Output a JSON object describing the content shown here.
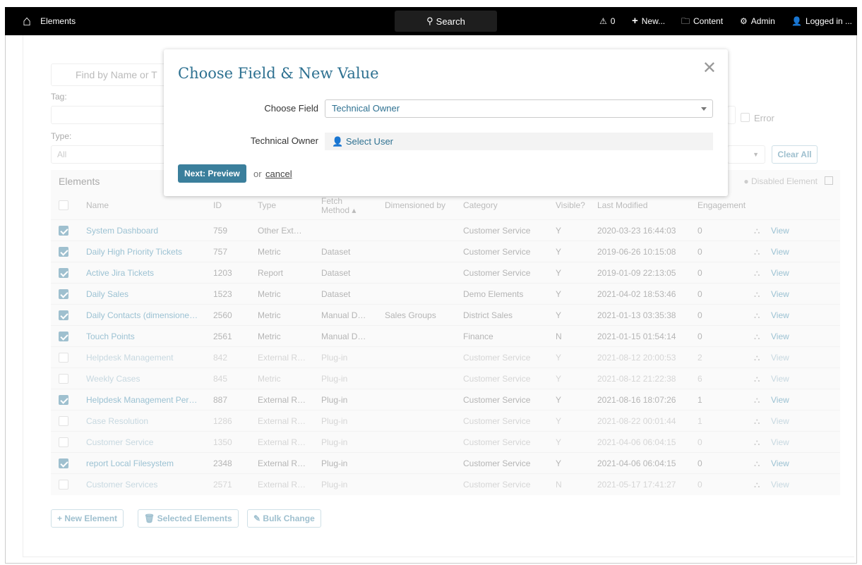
{
  "topbar": {
    "title": "Elements",
    "search": "Search",
    "alerts": "0",
    "new": "New...",
    "content": "Content",
    "admin": "Admin",
    "user": "Logged in ..."
  },
  "filters": {
    "search_placeholder": "Find by Name or T",
    "tag_label": "Tag:",
    "type_label": "Type:",
    "type_value": "All",
    "error_label": "Error",
    "clear_all": "Clear All"
  },
  "table": {
    "title": "Elements",
    "legend": "Disabled Element",
    "columns": [
      "Name",
      "ID",
      "Type",
      "Fetch Method",
      "Dimensioned by",
      "Category",
      "Visible?",
      "Last Modified",
      "Engagement"
    ],
    "view_label": "View",
    "rows": [
      {
        "checked": true,
        "disabled": false,
        "name": "System Dashboard",
        "id": "759",
        "type": "Other Ext…",
        "fetch": "",
        "dim": "",
        "category": "Customer Service",
        "visible": "Y",
        "modified": "2020-03-23 16:44:03",
        "engagement": "0"
      },
      {
        "checked": true,
        "disabled": false,
        "name": "Daily High Priority Tickets",
        "id": "757",
        "type": "Metric",
        "fetch": "Dataset",
        "dim": "",
        "category": "Customer Service",
        "visible": "Y",
        "modified": "2019-06-26 10:15:08",
        "engagement": "0"
      },
      {
        "checked": true,
        "disabled": false,
        "name": "Active Jira Tickets",
        "id": "1203",
        "type": "Report",
        "fetch": "Dataset",
        "dim": "",
        "category": "Customer Service",
        "visible": "Y",
        "modified": "2019-01-09 22:13:05",
        "engagement": "0"
      },
      {
        "checked": true,
        "disabled": false,
        "name": "Daily Sales",
        "id": "1523",
        "type": "Metric",
        "fetch": "Dataset",
        "dim": "",
        "category": "Demo Elements",
        "visible": "Y",
        "modified": "2021-04-02 18:53:46",
        "engagement": "0"
      },
      {
        "checked": true,
        "disabled": false,
        "name": "Daily Contacts (dimensione…",
        "id": "2560",
        "type": "Metric",
        "fetch": "Manual D…",
        "dim": "Sales Groups",
        "category": "District Sales",
        "visible": "Y",
        "modified": "2021-01-13 03:35:38",
        "engagement": "0"
      },
      {
        "checked": true,
        "disabled": false,
        "name": "Touch Points",
        "id": "2561",
        "type": "Metric",
        "fetch": "Manual D…",
        "dim": "",
        "category": "Finance",
        "visible": "N",
        "modified": "2021-01-15 01:54:14",
        "engagement": "0"
      },
      {
        "checked": false,
        "disabled": true,
        "name": "Helpdesk Management",
        "id": "842",
        "type": "External R…",
        "fetch": "Plug-in",
        "dim": "",
        "category": "Customer Service",
        "visible": "Y",
        "modified": "2021-08-12 20:00:53",
        "engagement": "2"
      },
      {
        "checked": false,
        "disabled": true,
        "name": "Weekly Cases",
        "id": "845",
        "type": "Metric",
        "fetch": "Plug-in",
        "dim": "",
        "category": "Customer Service",
        "visible": "Y",
        "modified": "2021-08-12 21:22:38",
        "engagement": "6"
      },
      {
        "checked": true,
        "disabled": false,
        "name": "Helpdesk Management Per…",
        "id": "887",
        "type": "External R…",
        "fetch": "Plug-in",
        "dim": "",
        "category": "Customer Service",
        "visible": "Y",
        "modified": "2021-08-16 18:07:26",
        "engagement": "1"
      },
      {
        "checked": false,
        "disabled": true,
        "name": "Case Resolution",
        "id": "1286",
        "type": "External R…",
        "fetch": "Plug-in",
        "dim": "",
        "category": "Customer Service",
        "visible": "Y",
        "modified": "2021-08-22 00:01:44",
        "engagement": "1"
      },
      {
        "checked": false,
        "disabled": true,
        "name": "Customer Service",
        "id": "1350",
        "type": "External R…",
        "fetch": "Plug-in",
        "dim": "",
        "category": "Customer Service",
        "visible": "Y",
        "modified": "2021-04-06 06:04:15",
        "engagement": "0"
      },
      {
        "checked": true,
        "disabled": false,
        "name": "report Local Filesystem",
        "id": "2348",
        "type": "External R…",
        "fetch": "Plug-in",
        "dim": "",
        "category": "Customer Service",
        "visible": "Y",
        "modified": "2021-04-06 06:04:15",
        "engagement": "0"
      },
      {
        "checked": false,
        "disabled": true,
        "name": "Customer Services",
        "id": "2571",
        "type": "External R…",
        "fetch": "Plug-in",
        "dim": "",
        "category": "Customer Service",
        "visible": "N",
        "modified": "2021-05-17 17:41:27",
        "engagement": "0"
      }
    ]
  },
  "actions": {
    "new_element": "New Element",
    "selected": "Selected Elements",
    "bulk": "Bulk Change"
  },
  "modal": {
    "title": "Choose Field & New Value",
    "choose_field_label": "Choose Field",
    "choose_field_value": "Technical Owner",
    "owner_label": "Technical Owner",
    "select_user": "Select User",
    "next": "Next: Preview",
    "or": "or",
    "cancel": "cancel"
  }
}
